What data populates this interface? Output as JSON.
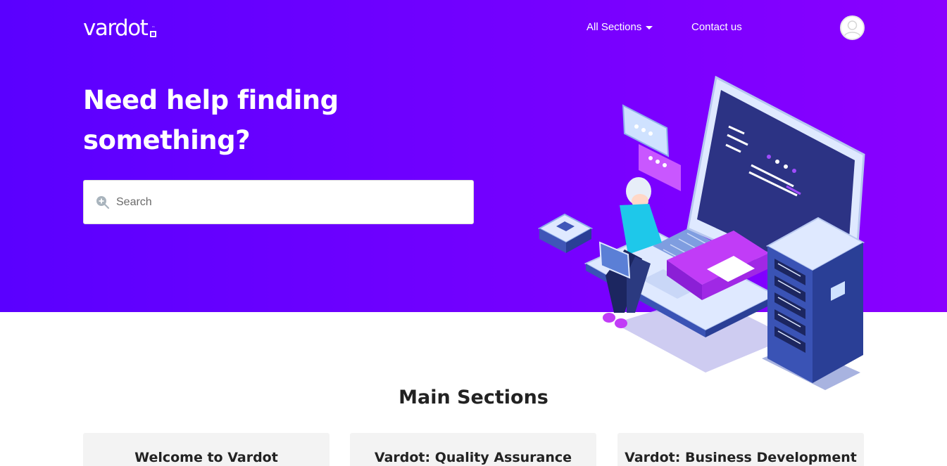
{
  "header": {
    "logo_text": "vardot",
    "logo_tm": "™",
    "nav": {
      "sections_label": "All Sections",
      "contact_label": "Contact us"
    }
  },
  "hero": {
    "title": "Need help finding something?",
    "search": {
      "placeholder": "Search",
      "value": ""
    }
  },
  "main": {
    "sections_heading": "Main Sections",
    "cards": [
      {
        "title": "Welcome to Vardot"
      },
      {
        "title": "Vardot: Quality Assurance"
      },
      {
        "title": "Vardot: Business Development"
      }
    ]
  },
  "icons": {
    "search": "search-icon",
    "caret": "caret-down-icon",
    "avatar": "user-avatar-icon"
  },
  "colors": {
    "hero_gradient_start": "#5a00ff",
    "hero_gradient_end": "#8a00ff",
    "card_background": "#f3f3f3"
  }
}
